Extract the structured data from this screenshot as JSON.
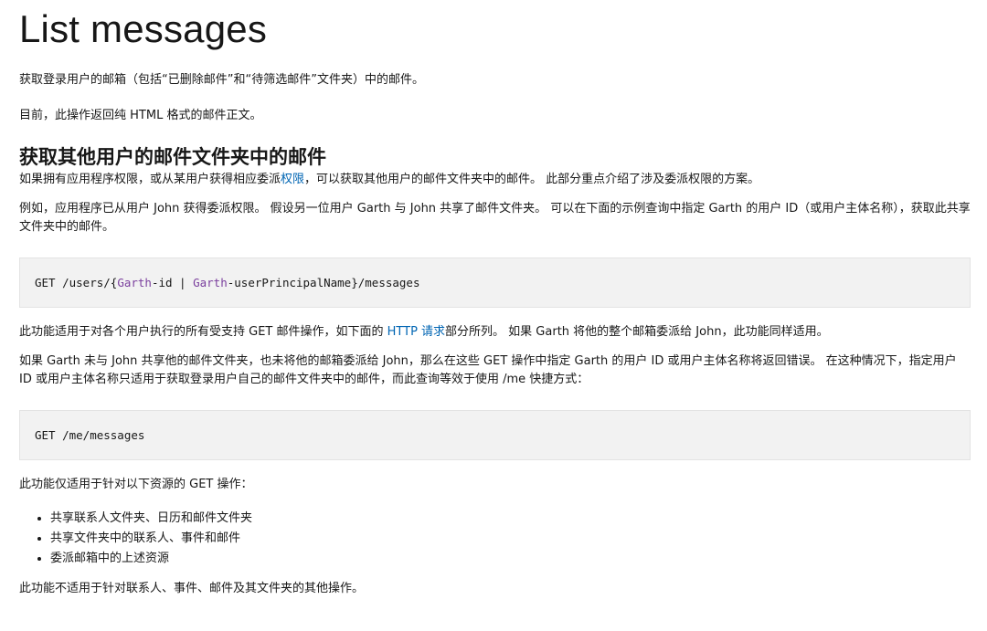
{
  "page_title": "List messages",
  "intro": {
    "p1": "获取登录用户的邮箱（包括“已删除邮件”和“待筛选邮件”文件夹）中的邮件。",
    "p2": "目前，此操作返回纯 HTML 格式的邮件正文。"
  },
  "section": {
    "heading": "获取其他用户的邮件文件夹中的邮件",
    "p1_before_link": "如果拥有应用程序权限，或从某用户获得相应委派",
    "p1_link": "权限",
    "p1_after_link": "，可以获取其他用户的邮件文件夹中的邮件。 此部分重点介绍了涉及委派权限的方案。",
    "p2": "例如，应用程序已从用户 John 获得委派权限。 假设另一位用户 Garth 与 John 共享了邮件文件夹。 可以在下面的示例查询中指定 Garth 的用户 ID（或用户主体名称），获取此共享文件夹中的邮件。",
    "code1": {
      "method": "GET",
      "path_start": " /users/{",
      "param1": "Garth",
      "param1_suffix": "-id | ",
      "param2": "Garth",
      "param2_suffix": "-userPrincipalName",
      "path_end": "}/messages"
    },
    "p3_before_link": "此功能适用于对各个用户执行的所有受支持 GET 邮件操作，如下面的 ",
    "p3_link": "HTTP 请求",
    "p3_after_link": "部分所列。 如果 Garth 将他的整个邮箱委派给 John，此功能同样适用。",
    "p4": "如果 Garth 未与 John 共享他的邮件文件夹，也未将他的邮箱委派给 John，那么在这些 GET 操作中指定 Garth 的用户 ID 或用户主体名称将返回错误。 在这种情况下，指定用户 ID 或用户主体名称只适用于获取登录用户自己的邮件文件夹中的邮件，而此查询等效于使用 /me 快捷方式：",
    "code2": "GET /me/messages",
    "p5": "此功能仅适用于针对以下资源的 GET 操作：",
    "bullets": [
      "共享联系人文件夹、日历和邮件文件夹",
      "共享文件夹中的联系人、事件和邮件",
      "委派邮箱中的上述资源"
    ],
    "p6": "此功能不适用于针对联系人、事件、邮件及其文件夹的其他操作。"
  },
  "colors": {
    "link": "#0065b3",
    "code_background": "#f2f2f2",
    "code_highlight": "#7a3e9d"
  }
}
